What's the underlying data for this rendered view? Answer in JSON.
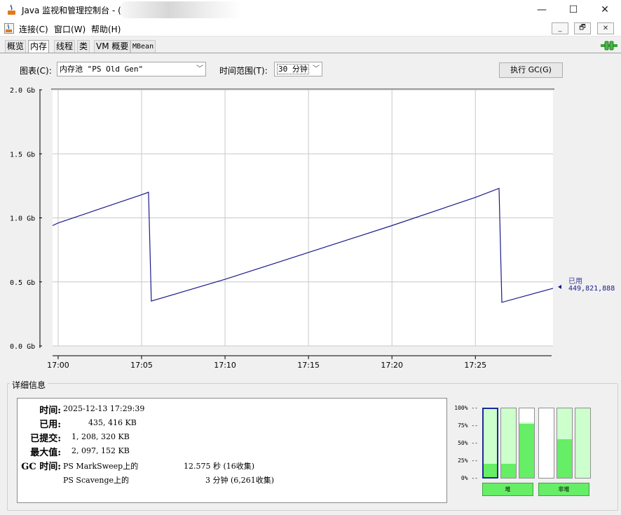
{
  "window": {
    "title": "Java 监视和管理控制台 - (",
    "minimize_glyph": "—",
    "maximize_glyph": "☐",
    "close_glyph": "✕"
  },
  "menu": {
    "items": [
      "连接(C)",
      "窗口(W)",
      "帮助(H)"
    ],
    "inner_buttons": [
      "_",
      "🗗",
      "✕"
    ]
  },
  "tabs": [
    "概览",
    "内存",
    "线程",
    "类",
    "VM 概要",
    "MBean"
  ],
  "active_tab": "内存",
  "controls": {
    "chart_label": "图表(C):",
    "chart_select": "内存池 \"PS Old Gen\"",
    "range_label": "时间范围(T):",
    "range_select": "30 分钟",
    "gc_button": "执行 GC(G)"
  },
  "chart_data": {
    "type": "line",
    "series": [
      {
        "name": "已用",
        "color": "#1a1a8c"
      }
    ],
    "y_ticks": [
      "2.0 Gb",
      "1.5 Gb",
      "1.0 Gb",
      "0.5 Gb",
      "0.0 Gb"
    ],
    "x_ticks": [
      "17:00",
      "17:05",
      "17:10",
      "17:15",
      "17:20",
      "17:25"
    ],
    "ylim": [
      0,
      2.0
    ],
    "xlim_minutes": [
      "16:59:40",
      "17:29:39"
    ],
    "points": [
      {
        "t": "16:59:40",
        "gb": 0.94
      },
      {
        "t": "17:00:00",
        "gb": 0.96
      },
      {
        "t": "17:05:00",
        "gb": 1.18
      },
      {
        "t": "17:05:25",
        "gb": 1.2
      },
      {
        "t": "17:05:35",
        "gb": 0.35
      },
      {
        "t": "17:10:00",
        "gb": 0.52
      },
      {
        "t": "17:15:00",
        "gb": 0.73
      },
      {
        "t": "17:20:00",
        "gb": 0.94
      },
      {
        "t": "17:25:00",
        "gb": 1.16
      },
      {
        "t": "17:26:25",
        "gb": 1.23
      },
      {
        "t": "17:26:35",
        "gb": 0.34
      },
      {
        "t": "17:29:39",
        "gb": 0.45
      }
    ],
    "current_label": "已用",
    "current_value": "449,821,888",
    "grid": true,
    "background": "#ffffff",
    "grid_color": "#c8c8c8"
  },
  "details": {
    "title": "详细信息",
    "time_key": "时间:",
    "time_val": "2025-12-13 17:29:39",
    "used_key": "已用:",
    "used_val": "435, 416 KB",
    "committed_key": "已提交:",
    "committed_val": "1, 208, 320 KB",
    "max_key": "最大值:",
    "max_val": "2, 097, 152 KB",
    "gc_key": "GC 时间:",
    "gc1_name": "PS MarkSweep上的",
    "gc1_val": "12.575 秒 (16收集)",
    "gc2_name": "PS Scavenge上的",
    "gc2_val": "3 分钟 (6,261收集)"
  },
  "pools": {
    "pct_labels": [
      "100% --",
      "75% --",
      "50% --",
      "25% --",
      "0% --"
    ],
    "heap_label": "堆",
    "nonheap_label": "非堆",
    "heap_bars": [
      {
        "used": 0.2,
        "committed": 1.0,
        "selected": true
      },
      {
        "used": 0.2,
        "committed": 1.0,
        "selected": false
      },
      {
        "used": 0.78,
        "committed": 0.8,
        "selected": false
      }
    ],
    "nonheap_bars": [
      {
        "used": 0.0,
        "committed": 0.0,
        "selected": false
      },
      {
        "used": 0.56,
        "committed": 1.0,
        "selected": false
      },
      {
        "used": 0.0,
        "committed": 1.0,
        "selected": false
      }
    ],
    "fill_color": "#66ee66",
    "committed_color": "#ccffcc"
  }
}
